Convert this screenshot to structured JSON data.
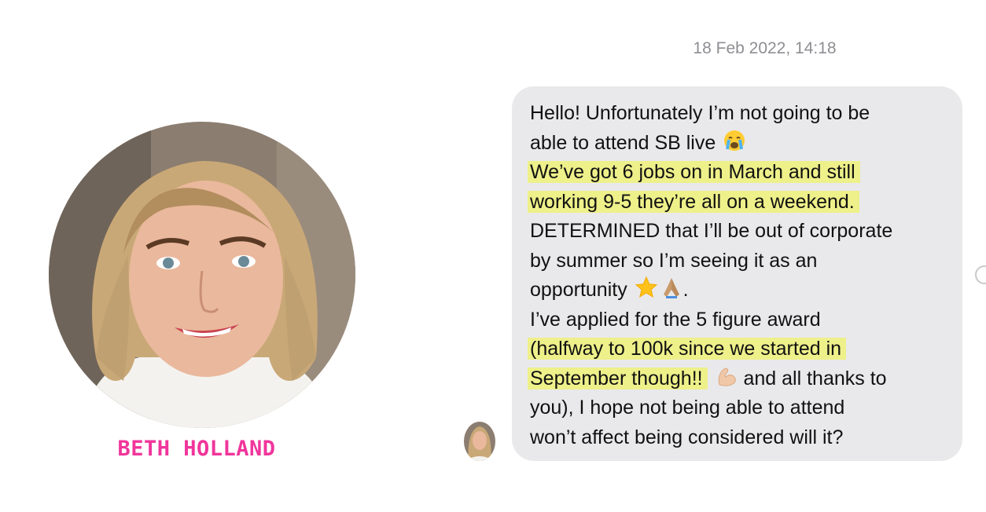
{
  "contact": {
    "name": "BETH HOLLAND"
  },
  "conversation": {
    "timestamp": "18 Feb 2022, 14:18",
    "message": {
      "line1": "Hello! Unfortunately I’m not going to be",
      "line2": "able to attend SB live",
      "line3": "We’ve got 6 jobs on in March and still",
      "line4": "working 9-5 they’re all on a weekend.",
      "line5": "DETERMINED that I’ll be out of corporate",
      "line6": "by summer so I’m seeing it as an",
      "line7": "opportunity",
      "line7_end": ".",
      "line8": "I’ve applied for the 5 figure award",
      "line9": "(halfway to 100k since we started in",
      "line10a": "September though!!",
      "line10b": "and all thanks to",
      "line11": "you), I hope not being able to attend",
      "line12": "won’t affect being considered will it?"
    },
    "emoji_names": [
      "crying-face-icon",
      "star-icon",
      "praying-hands-icon",
      "flexed-biceps-icon"
    ]
  },
  "colors": {
    "bubble": "#e9e9eb",
    "highlight": "#eef08a",
    "name": "#f0359b",
    "timestamp": "#8e8e93"
  }
}
